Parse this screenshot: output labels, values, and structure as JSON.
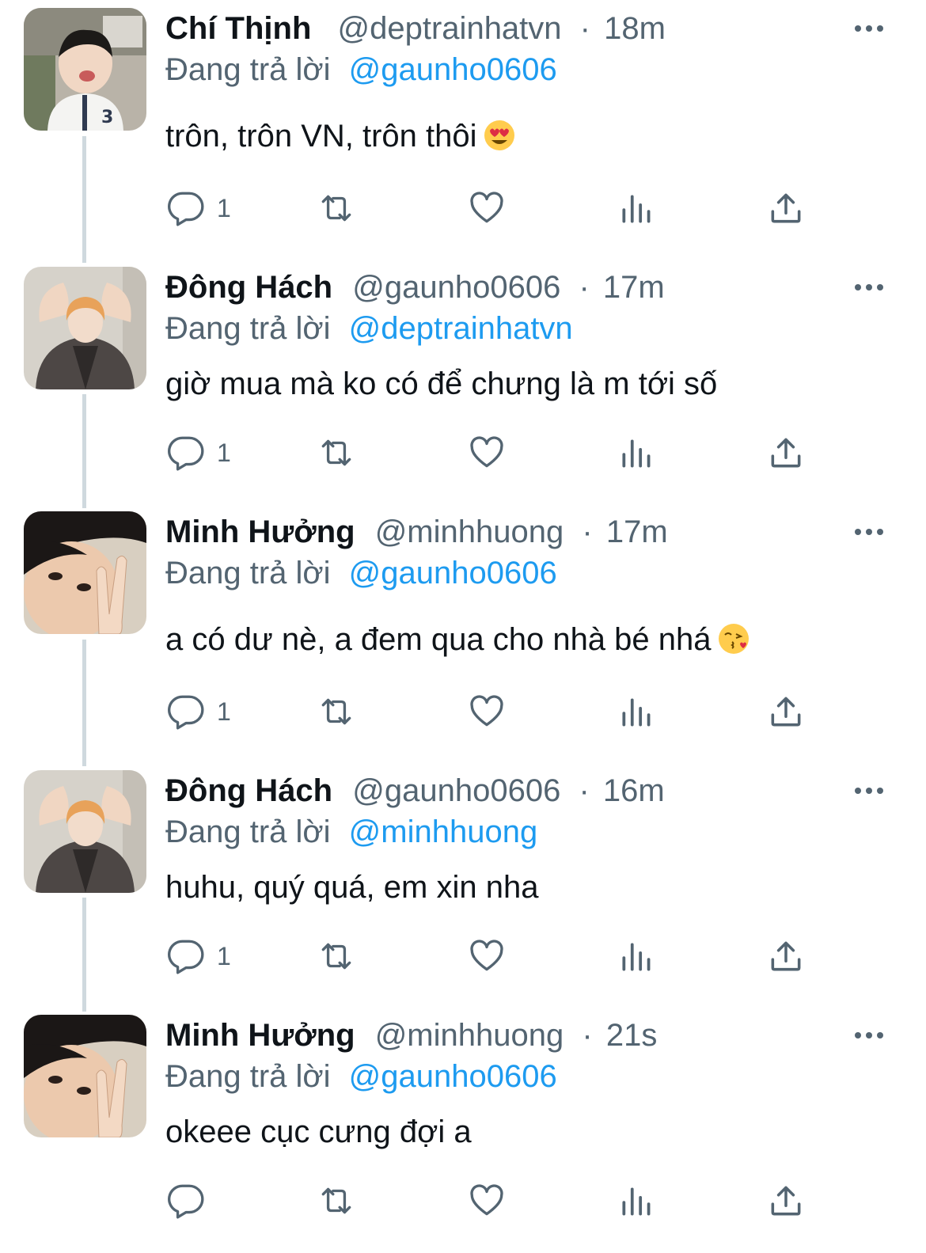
{
  "tweets": [
    {
      "display_name": "Chí Thịnh",
      "handle": "@deptrainhatvn",
      "separator": "·",
      "time": "18m",
      "reply_prefix": "Đang trả lời",
      "reply_to": "@gaunho0606",
      "text": "trôn, trôn VN, trôn thôi",
      "emoji": "heart-eyes-emoji",
      "reply_count": "1",
      "avatar": "child-avatar"
    },
    {
      "display_name": "Đông Hách",
      "handle": "@gaunho0606",
      "separator": "·",
      "time": "17m",
      "reply_prefix": "Đang trả lời",
      "reply_to": "@deptrainhatvn",
      "text": "giờ mua mà ko có để chưng là m tới số",
      "reply_count": "1",
      "avatar": "orange-hair-avatar"
    },
    {
      "display_name": "Minh Hưởng",
      "handle": "@minhhuong",
      "separator": "·",
      "time": "17m",
      "reply_prefix": "Đang trả lời",
      "reply_to": "@gaunho0606",
      "text": "a có dư nè, a đem qua cho nhà bé nhá",
      "emoji": "kiss-emoji",
      "reply_count": "1",
      "avatar": "peace-sign-avatar"
    },
    {
      "display_name": "Đông Hách",
      "handle": "@gaunho0606",
      "separator": "·",
      "time": "16m",
      "reply_prefix": "Đang trả lời",
      "reply_to": "@minhhuong",
      "text": "huhu, quý quá, em xin nha",
      "reply_count": "1",
      "avatar": "orange-hair-avatar"
    },
    {
      "display_name": "Minh Hưởng",
      "handle": "@minhhuong",
      "separator": "·",
      "time": "21s",
      "reply_prefix": "Đang trả lời",
      "reply_to": "@gaunho0606",
      "text": "okeee cục cưng đợi a",
      "reply_count": "",
      "avatar": "peace-sign-avatar"
    }
  ],
  "icons": {
    "more": "more-icon",
    "reply": "reply-icon",
    "retweet": "retweet-icon",
    "like": "like-icon",
    "views": "views-icon",
    "share": "share-icon"
  },
  "colors": {
    "accent": "#1d9bf0",
    "muted": "#536471",
    "text": "#0f1419",
    "thread_line": "#cfd9de"
  }
}
